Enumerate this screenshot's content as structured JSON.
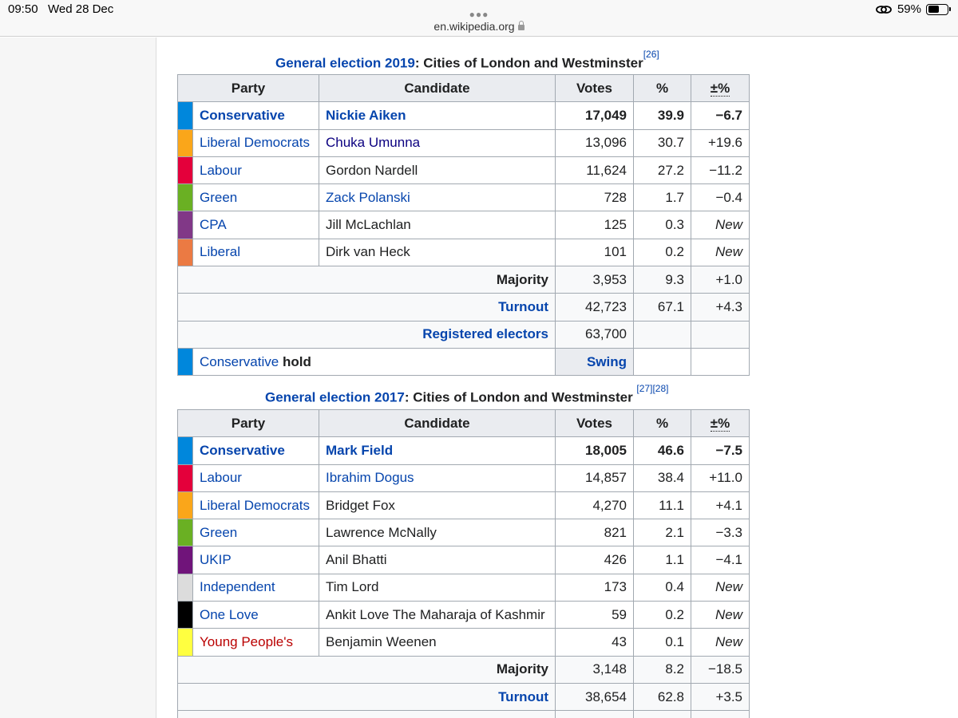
{
  "status": {
    "time": "09:50",
    "date": "Wed 28 Dec",
    "battery_text": "59%",
    "battery_level": 0.59
  },
  "browser": {
    "url": "en.wikipedia.org"
  },
  "headers": {
    "party": "Party",
    "candidate": "Candidate",
    "votes": "Votes",
    "percent": "%",
    "change": "±%"
  },
  "election2019": {
    "caption_link": "General election 2019",
    "caption_rest": ": Cities of London and Westminster",
    "caption_ref": "[26]",
    "rows": [
      {
        "color": "#0087dc",
        "party": "Conservative",
        "candidate": "Nickie Aiken",
        "votes": "17,049",
        "pct": "39.9",
        "chg": "−6.7",
        "winner": true,
        "cand_link": "blue"
      },
      {
        "color": "#faa61a",
        "party": "Liberal Democrats",
        "candidate": "Chuka Umunna",
        "votes": "13,096",
        "pct": "30.7",
        "chg": "+19.6",
        "winner": false,
        "cand_link": "dark"
      },
      {
        "color": "#e4003b",
        "party": "Labour",
        "candidate": "Gordon Nardell",
        "votes": "11,624",
        "pct": "27.2",
        "chg": "−11.2",
        "winner": false,
        "cand_link": "none"
      },
      {
        "color": "#6ab023",
        "party": "Green",
        "candidate": "Zack Polanski",
        "votes": "728",
        "pct": "1.7",
        "chg": "−0.4",
        "winner": false,
        "cand_link": "blue"
      },
      {
        "color": "#813887",
        "party": "CPA",
        "candidate": "Jill McLachlan",
        "votes": "125",
        "pct": "0.3",
        "chg": "New",
        "winner": false,
        "cand_link": "none"
      },
      {
        "color": "#eb7a43",
        "party": "Liberal",
        "candidate": "Dirk van Heck",
        "votes": "101",
        "pct": "0.2",
        "chg": "New",
        "winner": false,
        "cand_link": "none"
      }
    ],
    "majority": {
      "label": "Majority",
      "votes": "3,953",
      "pct": "9.3",
      "chg": "+1.0"
    },
    "turnout": {
      "label": "Turnout",
      "votes": "42,723",
      "pct": "67.1",
      "chg": "+4.3"
    },
    "registered": {
      "label": "Registered electors",
      "votes": "63,700"
    },
    "hold": {
      "color": "#0087dc",
      "party": "Conservative",
      "word": "hold",
      "swing": "Swing"
    }
  },
  "election2017": {
    "caption_link": "General election 2017",
    "caption_rest": ": Cities of London and Westminster ",
    "caption_ref": "[27][28]",
    "rows": [
      {
        "color": "#0087dc",
        "party": "Conservative",
        "candidate": "Mark Field",
        "votes": "18,005",
        "pct": "46.6",
        "chg": "−7.5",
        "winner": true,
        "cand_link": "blue",
        "party_link": "blue"
      },
      {
        "color": "#e4003b",
        "party": "Labour",
        "candidate": "Ibrahim Dogus",
        "votes": "14,857",
        "pct": "38.4",
        "chg": "+11.0",
        "winner": false,
        "cand_link": "blue",
        "party_link": "blue"
      },
      {
        "color": "#faa61a",
        "party": "Liberal Democrats",
        "candidate": "Bridget Fox",
        "votes": "4,270",
        "pct": "11.1",
        "chg": "+4.1",
        "winner": false,
        "cand_link": "none",
        "party_link": "blue"
      },
      {
        "color": "#6ab023",
        "party": "Green",
        "candidate": "Lawrence McNally",
        "votes": "821",
        "pct": "2.1",
        "chg": "−3.3",
        "winner": false,
        "cand_link": "none",
        "party_link": "blue"
      },
      {
        "color": "#70147a",
        "party": "UKIP",
        "candidate": "Anil Bhatti",
        "votes": "426",
        "pct": "1.1",
        "chg": "−4.1",
        "winner": false,
        "cand_link": "none",
        "party_link": "blue"
      },
      {
        "color": "#dcdcdc",
        "party": "Independent",
        "candidate": "Tim Lord",
        "votes": "173",
        "pct": "0.4",
        "chg": "New",
        "winner": false,
        "cand_link": "none",
        "party_link": "blue"
      },
      {
        "color": "#000000",
        "party": "One Love",
        "candidate": "Ankit Love The Maharaja of Kashmir",
        "votes": "59",
        "pct": "0.2",
        "chg": "New",
        "winner": false,
        "cand_link": "none",
        "party_link": "blue"
      },
      {
        "color": "#ffff40",
        "party": "Young People's",
        "candidate": "Benjamin Weenen",
        "votes": "43",
        "pct": "0.1",
        "chg": "New",
        "winner": false,
        "cand_link": "none",
        "party_link": "red"
      }
    ],
    "majority": {
      "label": "Majority",
      "votes": "3,148",
      "pct": "8.2",
      "chg": "−18.5"
    },
    "turnout": {
      "label": "Turnout",
      "votes": "38,654",
      "pct": "62.8",
      "chg": "+3.5"
    }
  }
}
